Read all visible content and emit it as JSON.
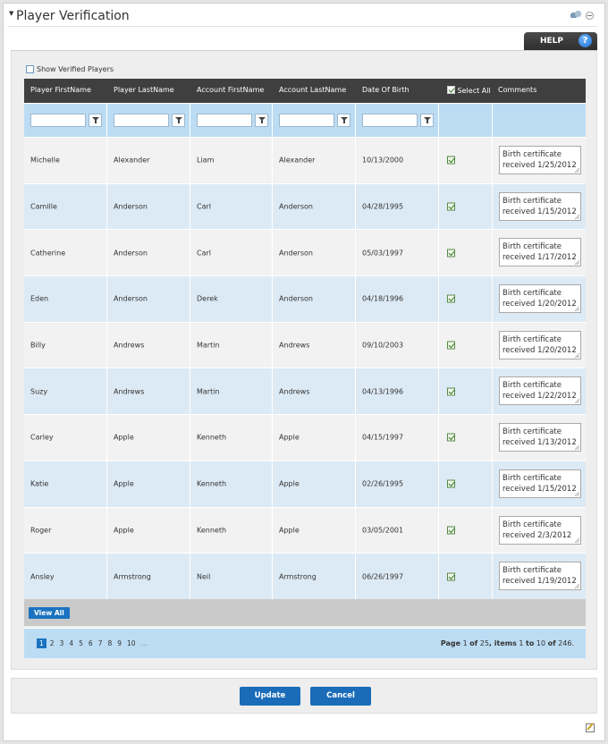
{
  "title": "Player Verification",
  "help_label": "HELP",
  "help_icon": "?",
  "show_verified_label": "Show Verified Players",
  "columns": [
    "Player FirstName",
    "Player LastName",
    "Account FirstName",
    "Account LastName",
    "Date Of Birth",
    "Select All",
    "Comments"
  ],
  "rows": [
    {
      "pfirst": "Michelle",
      "plast": "Alexander",
      "afirst": "Liam",
      "alast": "Alexander",
      "dob": "10/13/2000",
      "comment": "Birth certificate received 1/25/2012",
      "checked": true
    },
    {
      "pfirst": "Camille",
      "plast": "Anderson",
      "afirst": "Carl",
      "alast": "Anderson",
      "dob": "04/28/1995",
      "comment": "Birth certificate received 1/15/2012",
      "checked": true
    },
    {
      "pfirst": "Catherine",
      "plast": "Anderson",
      "afirst": "Carl",
      "alast": "Anderson",
      "dob": "05/03/1997",
      "comment": "Birth certificate received 1/17/2012",
      "checked": true
    },
    {
      "pfirst": "Eden",
      "plast": "Anderson",
      "afirst": "Derek",
      "alast": "Anderson",
      "dob": "04/18/1996",
      "comment": "Birth certificate received 1/20/2012",
      "checked": true
    },
    {
      "pfirst": "Billy",
      "plast": "Andrews",
      "afirst": "Martin",
      "alast": "Andrews",
      "dob": "09/10/2003",
      "comment": "Birth certificate received 1/20/2012",
      "checked": true
    },
    {
      "pfirst": "Suzy",
      "plast": "Andrews",
      "afirst": "Martin",
      "alast": "Andrews",
      "dob": "04/13/1996",
      "comment": "Birth certificate received 1/22/2012",
      "checked": true
    },
    {
      "pfirst": "Carley",
      "plast": "Apple",
      "afirst": "Kenneth",
      "alast": "Apple",
      "dob": "04/15/1997",
      "comment": "Birth certificate received 1/13/2012",
      "checked": true
    },
    {
      "pfirst": "Katie",
      "plast": "Apple",
      "afirst": "Kenneth",
      "alast": "Apple",
      "dob": "02/26/1995",
      "comment": "Birth certificate received 1/15/2012",
      "checked": true
    },
    {
      "pfirst": "Roger",
      "plast": "Apple",
      "afirst": "Kenneth",
      "alast": "Apple",
      "dob": "03/05/2001",
      "comment": "Birth certificate received 2/3/2012",
      "checked": true
    },
    {
      "pfirst": "Ansley",
      "plast": "Armstrong",
      "afirst": "Neil",
      "alast": "Armstrong",
      "dob": "06/26/1997",
      "comment": "Birth certificate received 1/19/2012",
      "checked": true
    }
  ],
  "view_all_label": "View All",
  "pager": {
    "pages": [
      "1",
      "2",
      "3",
      "4",
      "5",
      "6",
      "7",
      "8",
      "9",
      "10",
      "..."
    ],
    "current": "1",
    "page_word": "Page",
    "page_num": "1",
    "of_word": "of",
    "page_total": "25",
    "items_word": ", items",
    "item_from": "1",
    "to_word": "to",
    "item_to": "10",
    "item_total": "246"
  },
  "buttons": {
    "update": "Update",
    "cancel": "Cancel"
  },
  "colors": {
    "header": "#3f3f3f",
    "filter_row": "#bcdcf3",
    "alt_row": "#dceaf5",
    "button": "#1a6bb8"
  }
}
